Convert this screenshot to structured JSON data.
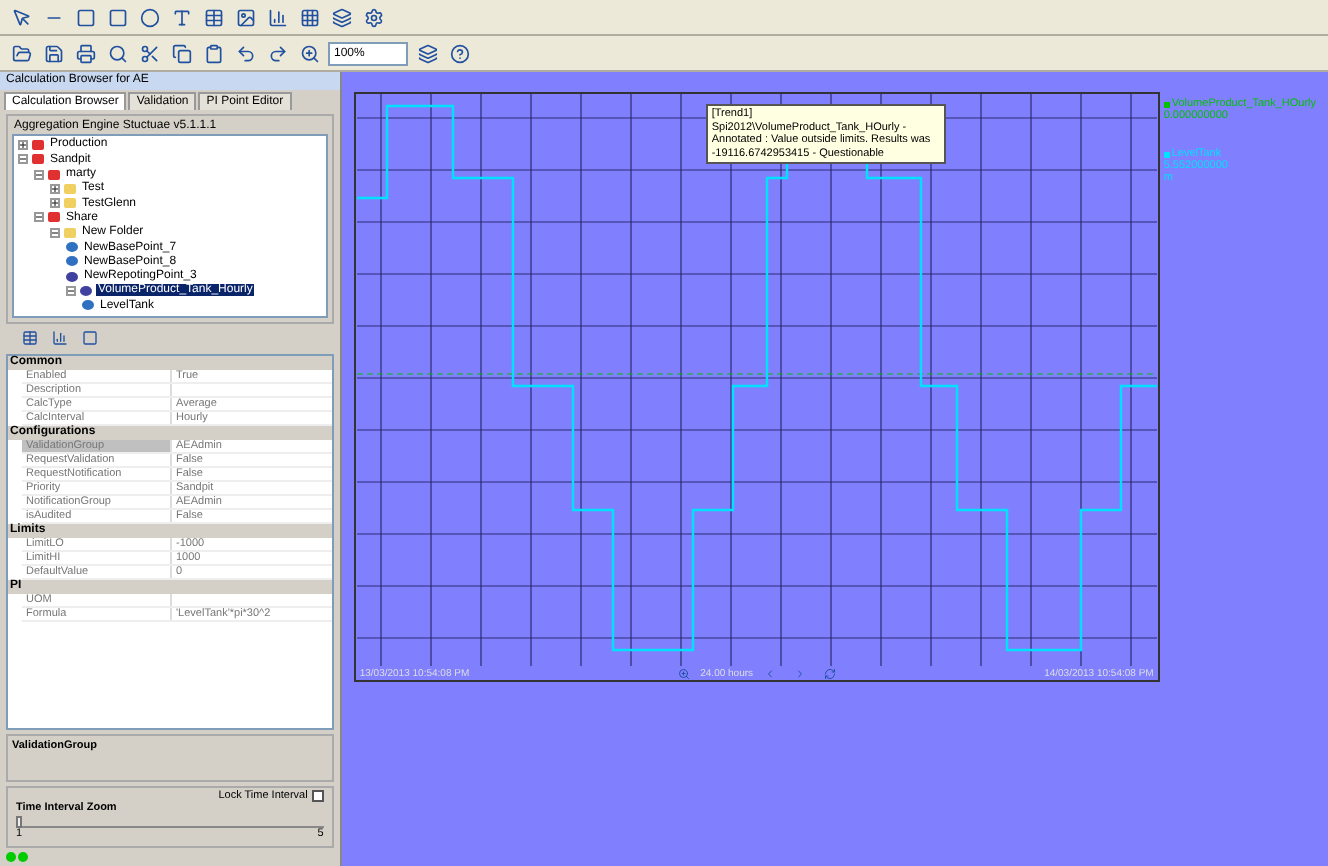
{
  "toolbar": {
    "zoom": "100%"
  },
  "panel": {
    "title": "Calculation Browser for AE",
    "tabs": [
      {
        "label": "Calculation Browser",
        "selected": true
      },
      {
        "label": "Validation",
        "selected": false
      },
      {
        "label": "PI Point Editor",
        "selected": false
      }
    ],
    "tree_title": "Aggregation Engine Stuctuae v5.1.1.1",
    "tree": [
      {
        "label": "Production",
        "kind": "group",
        "expanded": false,
        "selected": false
      },
      {
        "label": "Sandpit",
        "kind": "group",
        "expanded": true,
        "selected": false,
        "children": [
          {
            "label": "marty",
            "kind": "group",
            "expanded": true,
            "selected": false,
            "children": [
              {
                "label": "Test",
                "kind": "folder",
                "expanded": false,
                "selected": false
              },
              {
                "label": "TestGlenn",
                "kind": "folder",
                "expanded": false,
                "selected": false
              }
            ]
          },
          {
            "label": "Share",
            "kind": "group",
            "expanded": true,
            "selected": false,
            "children": [
              {
                "label": "New Folder",
                "kind": "folder",
                "expanded": true,
                "selected": false,
                "children": [
                  {
                    "label": "NewBasePoint_7",
                    "kind": "point",
                    "selected": false
                  },
                  {
                    "label": "NewBasePoint_8",
                    "kind": "point",
                    "selected": false
                  },
                  {
                    "label": "NewRepotingPoint_3",
                    "kind": "calc",
                    "selected": false
                  },
                  {
                    "label": "VolumeProduct_Tank_Hourly",
                    "kind": "calc",
                    "expanded": true,
                    "selected": true,
                    "children": [
                      {
                        "label": "LevelTank",
                        "kind": "point",
                        "selected": false
                      }
                    ]
                  }
                ]
              }
            ]
          }
        ]
      }
    ],
    "properties": [
      {
        "section": "Common",
        "rows": [
          {
            "name": "Enabled",
            "value": "True",
            "selected": false
          },
          {
            "name": "Description",
            "value": "",
            "selected": false
          },
          {
            "name": "CalcType",
            "value": "Average",
            "selected": false
          },
          {
            "name": "CalcInterval",
            "value": "Hourly",
            "selected": false
          }
        ]
      },
      {
        "section": "Configurations",
        "rows": [
          {
            "name": "ValidationGroup",
            "value": "AEAdmin",
            "selected": true
          },
          {
            "name": "RequestValidation",
            "value": "False",
            "selected": false
          },
          {
            "name": "RequestNotification",
            "value": "False",
            "selected": false
          },
          {
            "name": "Priority",
            "value": "Sandpit",
            "selected": false
          },
          {
            "name": "NotificationGroup",
            "value": "AEAdmin",
            "selected": false
          },
          {
            "name": "isAudited",
            "value": "False",
            "selected": false
          }
        ]
      },
      {
        "section": "Limits",
        "rows": [
          {
            "name": "LimitLO",
            "value": "-1000",
            "selected": false
          },
          {
            "name": "LimitHI",
            "value": "1000",
            "selected": false
          },
          {
            "name": "DefaultValue",
            "value": "0",
            "selected": false
          }
        ]
      },
      {
        "section": "PI",
        "rows": [
          {
            "name": "UOM",
            "value": "",
            "selected": false
          },
          {
            "name": "Formula",
            "value": "'LevelTank'*pi*30^2",
            "selected": false
          }
        ]
      }
    ],
    "description_title": "ValidationGroup",
    "time_zoom": {
      "title": "Time Interval Zoom",
      "lock_label": "Lock Time Interval",
      "lock_checked": false,
      "level": 0,
      "min_label": "1",
      "max_label": "5"
    }
  },
  "trend": {
    "tooltip": {
      "title": "[Trend1]",
      "text": "Spi2012\\VolumeProduct_Tank_HOurly - Annotated : Value outside limits.  Results was -19116.6742953415 - Questionable"
    },
    "legend": [
      {
        "name": "VolumeProduct_Tank_HOurly",
        "value": "0.000000000",
        "color": "#00c000"
      },
      {
        "name": "LevelTank",
        "value": "5.552000000",
        "unit": "m",
        "color": "#00e0ff"
      }
    ],
    "start_time": "13/03/2013 10:54:08 PM",
    "end_time": "14/03/2013 10:54:08 PM",
    "span": "24.00 hours"
  }
}
